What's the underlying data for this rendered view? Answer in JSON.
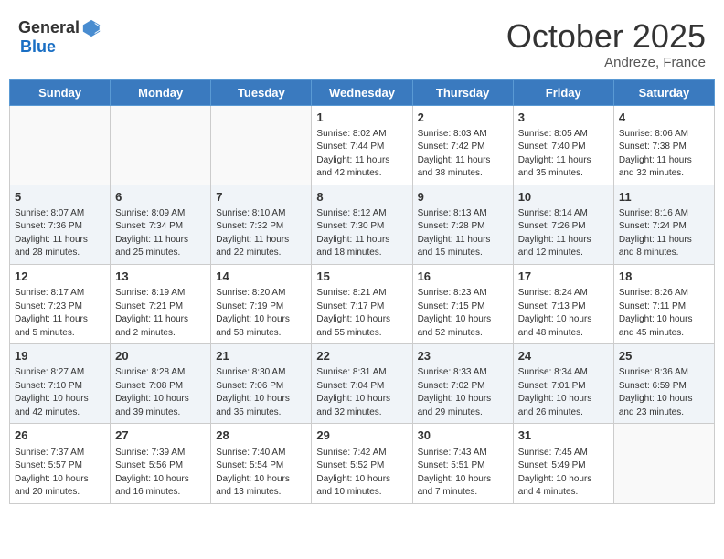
{
  "header": {
    "logo_general": "General",
    "logo_blue": "Blue",
    "month": "October 2025",
    "location": "Andreze, France"
  },
  "weekdays": [
    "Sunday",
    "Monday",
    "Tuesday",
    "Wednesday",
    "Thursday",
    "Friday",
    "Saturday"
  ],
  "weeks": [
    [
      {
        "day": "",
        "info": ""
      },
      {
        "day": "",
        "info": ""
      },
      {
        "day": "",
        "info": ""
      },
      {
        "day": "1",
        "info": "Sunrise: 8:02 AM\nSunset: 7:44 PM\nDaylight: 11 hours\nand 42 minutes."
      },
      {
        "day": "2",
        "info": "Sunrise: 8:03 AM\nSunset: 7:42 PM\nDaylight: 11 hours\nand 38 minutes."
      },
      {
        "day": "3",
        "info": "Sunrise: 8:05 AM\nSunset: 7:40 PM\nDaylight: 11 hours\nand 35 minutes."
      },
      {
        "day": "4",
        "info": "Sunrise: 8:06 AM\nSunset: 7:38 PM\nDaylight: 11 hours\nand 32 minutes."
      }
    ],
    [
      {
        "day": "5",
        "info": "Sunrise: 8:07 AM\nSunset: 7:36 PM\nDaylight: 11 hours\nand 28 minutes."
      },
      {
        "day": "6",
        "info": "Sunrise: 8:09 AM\nSunset: 7:34 PM\nDaylight: 11 hours\nand 25 minutes."
      },
      {
        "day": "7",
        "info": "Sunrise: 8:10 AM\nSunset: 7:32 PM\nDaylight: 11 hours\nand 22 minutes."
      },
      {
        "day": "8",
        "info": "Sunrise: 8:12 AM\nSunset: 7:30 PM\nDaylight: 11 hours\nand 18 minutes."
      },
      {
        "day": "9",
        "info": "Sunrise: 8:13 AM\nSunset: 7:28 PM\nDaylight: 11 hours\nand 15 minutes."
      },
      {
        "day": "10",
        "info": "Sunrise: 8:14 AM\nSunset: 7:26 PM\nDaylight: 11 hours\nand 12 minutes."
      },
      {
        "day": "11",
        "info": "Sunrise: 8:16 AM\nSunset: 7:24 PM\nDaylight: 11 hours\nand 8 minutes."
      }
    ],
    [
      {
        "day": "12",
        "info": "Sunrise: 8:17 AM\nSunset: 7:23 PM\nDaylight: 11 hours\nand 5 minutes."
      },
      {
        "day": "13",
        "info": "Sunrise: 8:19 AM\nSunset: 7:21 PM\nDaylight: 11 hours\nand 2 minutes."
      },
      {
        "day": "14",
        "info": "Sunrise: 8:20 AM\nSunset: 7:19 PM\nDaylight: 10 hours\nand 58 minutes."
      },
      {
        "day": "15",
        "info": "Sunrise: 8:21 AM\nSunset: 7:17 PM\nDaylight: 10 hours\nand 55 minutes."
      },
      {
        "day": "16",
        "info": "Sunrise: 8:23 AM\nSunset: 7:15 PM\nDaylight: 10 hours\nand 52 minutes."
      },
      {
        "day": "17",
        "info": "Sunrise: 8:24 AM\nSunset: 7:13 PM\nDaylight: 10 hours\nand 48 minutes."
      },
      {
        "day": "18",
        "info": "Sunrise: 8:26 AM\nSunset: 7:11 PM\nDaylight: 10 hours\nand 45 minutes."
      }
    ],
    [
      {
        "day": "19",
        "info": "Sunrise: 8:27 AM\nSunset: 7:10 PM\nDaylight: 10 hours\nand 42 minutes."
      },
      {
        "day": "20",
        "info": "Sunrise: 8:28 AM\nSunset: 7:08 PM\nDaylight: 10 hours\nand 39 minutes."
      },
      {
        "day": "21",
        "info": "Sunrise: 8:30 AM\nSunset: 7:06 PM\nDaylight: 10 hours\nand 35 minutes."
      },
      {
        "day": "22",
        "info": "Sunrise: 8:31 AM\nSunset: 7:04 PM\nDaylight: 10 hours\nand 32 minutes."
      },
      {
        "day": "23",
        "info": "Sunrise: 8:33 AM\nSunset: 7:02 PM\nDaylight: 10 hours\nand 29 minutes."
      },
      {
        "day": "24",
        "info": "Sunrise: 8:34 AM\nSunset: 7:01 PM\nDaylight: 10 hours\nand 26 minutes."
      },
      {
        "day": "25",
        "info": "Sunrise: 8:36 AM\nSunset: 6:59 PM\nDaylight: 10 hours\nand 23 minutes."
      }
    ],
    [
      {
        "day": "26",
        "info": "Sunrise: 7:37 AM\nSunset: 5:57 PM\nDaylight: 10 hours\nand 20 minutes."
      },
      {
        "day": "27",
        "info": "Sunrise: 7:39 AM\nSunset: 5:56 PM\nDaylight: 10 hours\nand 16 minutes."
      },
      {
        "day": "28",
        "info": "Sunrise: 7:40 AM\nSunset: 5:54 PM\nDaylight: 10 hours\nand 13 minutes."
      },
      {
        "day": "29",
        "info": "Sunrise: 7:42 AM\nSunset: 5:52 PM\nDaylight: 10 hours\nand 10 minutes."
      },
      {
        "day": "30",
        "info": "Sunrise: 7:43 AM\nSunset: 5:51 PM\nDaylight: 10 hours\nand 7 minutes."
      },
      {
        "day": "31",
        "info": "Sunrise: 7:45 AM\nSunset: 5:49 PM\nDaylight: 10 hours\nand 4 minutes."
      },
      {
        "day": "",
        "info": ""
      }
    ]
  ]
}
